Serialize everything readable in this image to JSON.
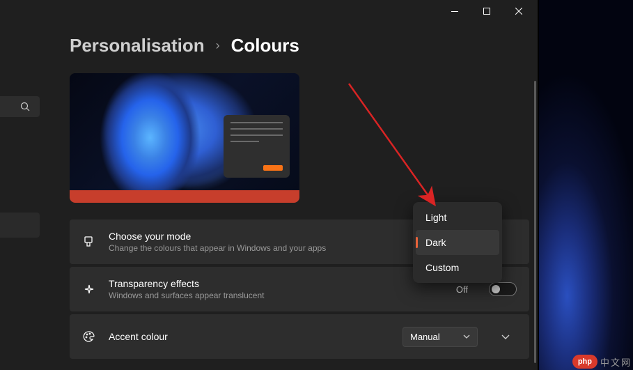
{
  "titlebar": {
    "minimize_icon": "minimize",
    "maximize_icon": "maximize",
    "close_icon": "close"
  },
  "breadcrumb": {
    "parent": "Personalisation",
    "separator": "›",
    "current": "Colours"
  },
  "settings": {
    "mode": {
      "title": "Choose your mode",
      "description": "Change the colours that appear in Windows and your apps"
    },
    "transparency": {
      "title": "Transparency effects",
      "description": "Windows and surfaces appear translucent",
      "value_label": "Off",
      "value": false
    },
    "accent": {
      "title": "Accent colour",
      "select_value": "Manual"
    }
  },
  "mode_dropdown": {
    "options": [
      "Light",
      "Dark",
      "Custom"
    ],
    "selected": "Dark"
  },
  "colors": {
    "accent": "#e8633a",
    "taskbar": "#c73e2c",
    "preview_accent": "#f97316"
  },
  "watermark": {
    "badge": "php",
    "text": "中文网"
  }
}
